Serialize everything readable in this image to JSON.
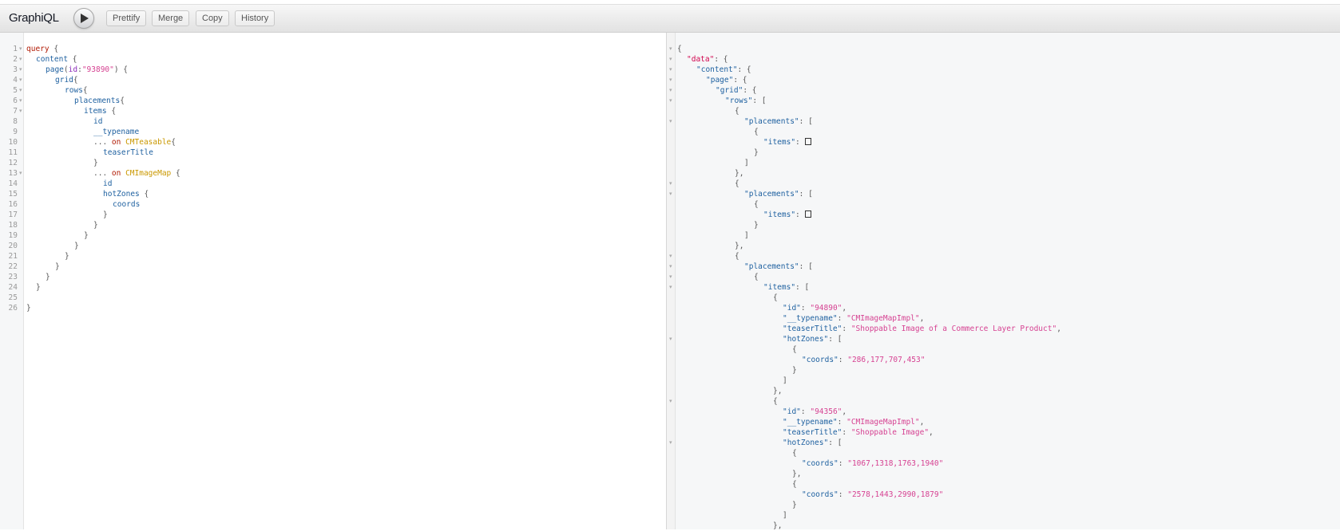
{
  "toolbar": {
    "title": "GraphiQL",
    "buttons": [
      "Prettify",
      "Merge",
      "Copy",
      "History"
    ]
  },
  "query_editor": {
    "line_numbers": [
      "1",
      "2",
      "3",
      "4",
      "5",
      "6",
      "7",
      "8",
      "9",
      "10",
      "11",
      "12",
      "13",
      "14",
      "15",
      "16",
      "17",
      "18",
      "19",
      "20",
      "21",
      "22",
      "23",
      "24",
      "25",
      "26"
    ],
    "tokens": {
      "query": "query",
      "brace_open": " {",
      "content": "content",
      "page": "page",
      "paren_open": "(",
      "id_arg": "id",
      "colon": ":",
      "id_value": "\"93890\"",
      "paren_close_brace": ") {",
      "grid": "grid",
      "rows": "rows",
      "placements": "placements",
      "items": "items",
      "id": "id",
      "typename": "__typename",
      "spread": "... ",
      "on": "on",
      "cmteasable": "CMTeasable",
      "teaserTitle": "teaserTitle",
      "cmimagemap": "CMImageMap",
      "hotZones": "hotZones",
      "coords": "coords",
      "brace_close": "}",
      "brace_inline": "{"
    }
  },
  "result_viewer": {
    "keys": {
      "data": "\"data\"",
      "content": "\"content\"",
      "page": "\"page\"",
      "grid": "\"grid\"",
      "rows": "\"rows\"",
      "placements": "\"placements\"",
      "items": "\"items\"",
      "id": "\"id\"",
      "typename": "\"__typename\"",
      "teaserTitle": "\"teaserTitle\"",
      "hotZones": "\"hotZones\"",
      "coords": "\"coords\""
    },
    "values": {
      "id_1": "\"94890\"",
      "typename_1": "\"CMImageMapImpl\"",
      "teaserTitle_1": "\"Shoppable Image of a Commerce Layer Product\"",
      "coords_1": "\"286,177,707,453\"",
      "id_2": "\"94356\"",
      "typename_2": "\"CMImageMapImpl\"",
      "teaserTitle_2": "\"Shoppable Image\"",
      "coords_2a": "\"1067,1318,1763,1940\"",
      "coords_2b": "\"2578,1443,2990,1879\""
    }
  },
  "colors": {
    "keyword": "#b11a04",
    "field": "#1f61a0",
    "string": "#d64292",
    "type": "#ca9800"
  }
}
